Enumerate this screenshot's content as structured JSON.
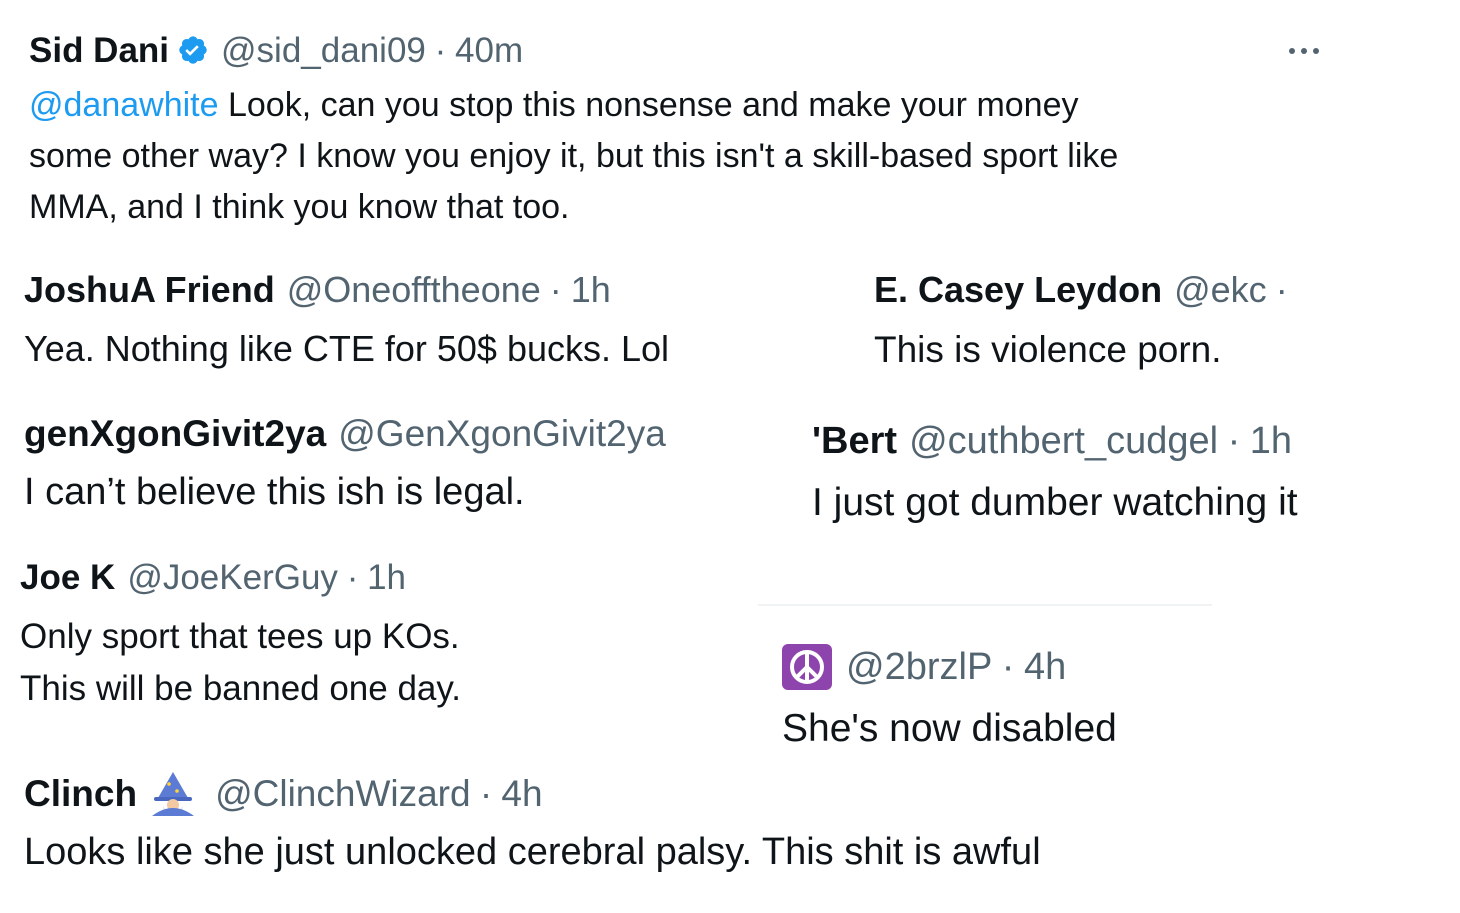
{
  "main_tweet": {
    "name": "Sid Dani",
    "handle": "@sid_dani09",
    "time": "40m",
    "mention": "@danawhite",
    "text_line1": " Look, can you stop this nonsense and make your money",
    "text_line2": "some other way? I know you enjoy it, but this isn't a skill-based sport like",
    "text_line3": "MMA, and I think you know that too.",
    "verified_color": "#1d9bf0"
  },
  "replies": {
    "joshua": {
      "name": "JoshuA Friend",
      "handle": "@Oneofftheone",
      "time": "1h",
      "text": "Yea. Nothing like CTE for 50$ bucks. Lol"
    },
    "casey": {
      "name": "E. Casey Leydon",
      "handle": "@ekc",
      "text": "This is violence porn."
    },
    "genx": {
      "name": "genXgonGivit2ya",
      "handle": "@GenXgonGivit2ya",
      "text": "I can’t believe this ish is legal."
    },
    "bert": {
      "name": "'Bert",
      "handle": "@cuthbert_cudgel",
      "time": "1h",
      "text": "I just got dumber watching it"
    },
    "joek": {
      "name": "Joe K",
      "handle": "@JoeKerGuy",
      "time": "1h",
      "text_line1": "Only sport that tees up KOs.",
      "text_line2": "This will be banned one day."
    },
    "brzl": {
      "name_icon": "peace-symbol-icon",
      "handle": "@2brzlP",
      "time": "4h",
      "text": "She's now disabled",
      "icon_color": "#8e44ad"
    },
    "clinch": {
      "name": "Clinch",
      "name_icon": "wizard-emoji-icon",
      "handle": "@ClinchWizard",
      "time": "4h",
      "text": "Looks like she just unlocked cerebral palsy. This shit is awful"
    }
  },
  "separator": "·",
  "more_icon": "more-dots-icon"
}
